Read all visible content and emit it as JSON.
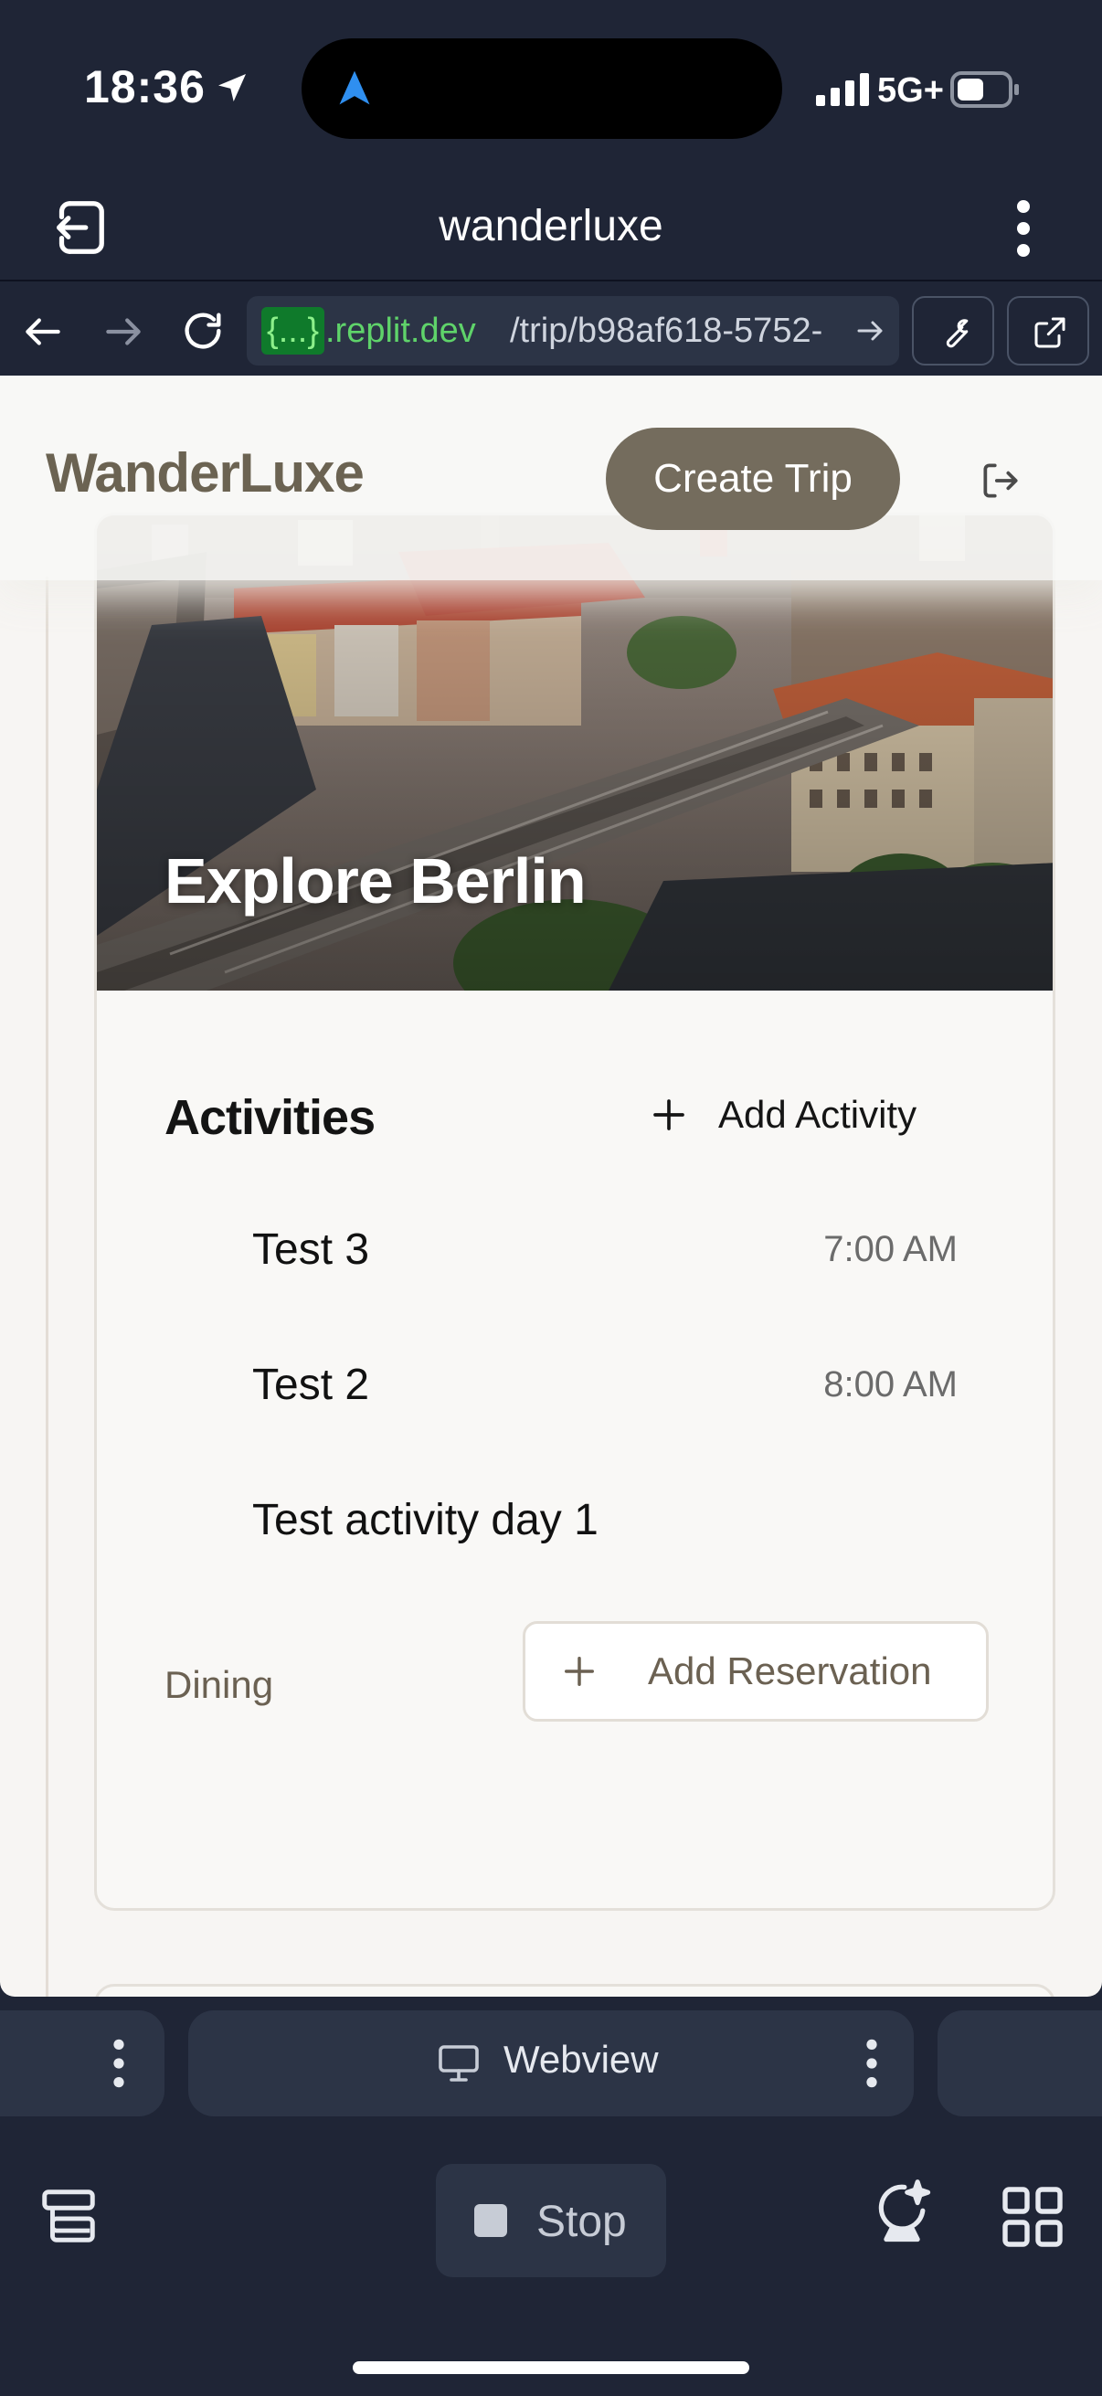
{
  "status_bar": {
    "time": "18:36",
    "network": "5G+",
    "icons": [
      "location-arrow-icon",
      "navigation-arrow-icon",
      "signal-icon",
      "battery-icon"
    ]
  },
  "app_header": {
    "title": "wanderluxe",
    "icons": [
      "exit-icon",
      "more-vertical-icon"
    ]
  },
  "url_bar": {
    "highlight": "{...}",
    "domain": ".replit.dev",
    "path": "/trip/b98af618-5752-",
    "icons": [
      "back-arrow-icon",
      "forward-arrow-icon",
      "reload-icon",
      "go-arrow-icon",
      "wrench-icon",
      "external-link-icon"
    ]
  },
  "webpage": {
    "nav": {
      "brand": "WanderLuxe",
      "create_trip_label": "Create Trip",
      "logout_icon": "logout-icon"
    },
    "day_card": {
      "hero_title": "Explore Berlin",
      "activities_heading": "Activities",
      "add_activity_label": "Add Activity",
      "activities": [
        {
          "name": "Test 3",
          "time": "7:00 AM"
        },
        {
          "name": "Test 2",
          "time": "8:00 AM"
        },
        {
          "name": "Test activity day 1",
          "time": ""
        }
      ],
      "dining_label": "Dining",
      "add_reservation_label": "Add Reservation"
    }
  },
  "bottom_tabs": {
    "active_tab_label": "Webview",
    "icons": [
      "monitor-icon",
      "more-vertical-icon"
    ]
  },
  "toolbar": {
    "stop_label": "Stop",
    "icons": [
      "layers-icon",
      "stop-icon",
      "ai-assistant-icon",
      "grid-icon"
    ]
  },
  "colors": {
    "chrome_bg": "#1f2536",
    "chrome_panel": "#2c3446",
    "url_green": "#5fd36a",
    "page_bg": "#f7f5f3",
    "brand_brown": "#6b6352",
    "button_brown": "#746c5d"
  }
}
